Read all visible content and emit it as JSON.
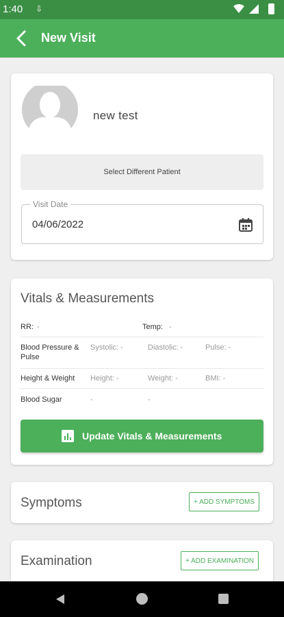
{
  "status_bar": {
    "time": "1:40",
    "download_icon": "download-icon",
    "wifi_icon": "wifi-icon",
    "signal_icon": "signal-icon",
    "battery_icon": "battery-icon"
  },
  "app_bar": {
    "title": "New Visit",
    "back_icon": "arrow-back-icon"
  },
  "patient": {
    "name": "new test",
    "select_label": "Select Different Patient",
    "visit_date_label": "Visit Date",
    "visit_date_value": "04/06/2022"
  },
  "vitals": {
    "title": "Vitals & Measurements",
    "rr_label": "RR:",
    "rr_value": "-",
    "temp_label": "Temp:",
    "temp_value": "-",
    "bp_label_line1": "Blood Pressure &",
    "bp_label_line2": "Pulse",
    "systolic": "Systolic: -",
    "diastolic": "Diastolic: -",
    "pulse": "Pulse: -",
    "hw_label": "Height & Weight",
    "height": "Height: -",
    "weight": "Weight: -",
    "bmi": "BMI: -",
    "sugar_label": "Blood Sugar",
    "sugar_val1": "-",
    "sugar_val2": "-",
    "update_label": "Update Vitals & Measurements"
  },
  "symptoms": {
    "title": "Symptoms",
    "add_label": "+ ADD SYMPTOMS"
  },
  "examination": {
    "title": "Examination",
    "add_label": "+ ADD EXAMINATION"
  },
  "colors": {
    "primary": "#4caf5a",
    "status_bar": "#3a8f44",
    "background": "#efefef"
  }
}
